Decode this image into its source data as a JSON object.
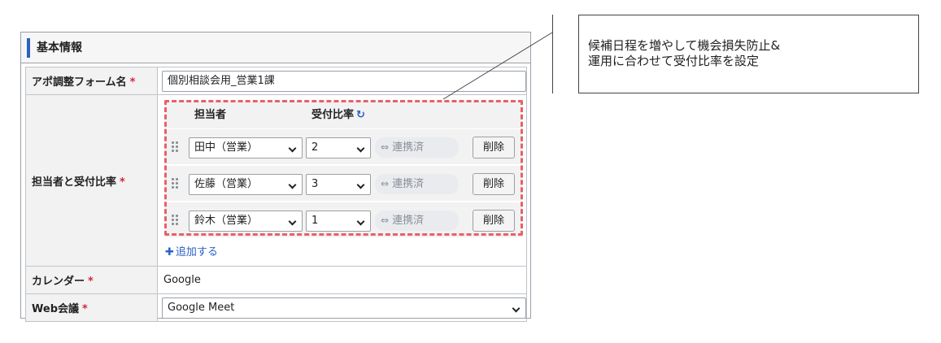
{
  "panel": {
    "title": "基本情報"
  },
  "form": {
    "form_name": {
      "label": "アポ調整フォーム名",
      "required_mark": "*",
      "value": "個別相談会用_営業1課"
    },
    "staff": {
      "label": "担当者と受付比率",
      "required_mark": "*",
      "header_person": "担当者",
      "header_ratio": "受付比率",
      "refresh_icon": "↻",
      "rows": [
        {
          "person": "田中（営業）",
          "ratio": "2",
          "link_icon": "⇔",
          "link_status": "連携済",
          "delete_label": "削除"
        },
        {
          "person": "佐藤（営業）",
          "ratio": "3",
          "link_icon": "⇔",
          "link_status": "連携済",
          "delete_label": "削除"
        },
        {
          "person": "鈴木（営業）",
          "ratio": "1",
          "link_icon": "⇔",
          "link_status": "連携済",
          "delete_label": "削除"
        }
      ],
      "add_icon": "✚",
      "add_label": "追加する"
    },
    "calendar": {
      "label": "カレンダー",
      "required_mark": "*",
      "value": "Google"
    },
    "web_meeting": {
      "label": "Web会議",
      "required_mark": "*",
      "value": "Google Meet"
    }
  },
  "callout": {
    "line1": "候補日程を増やして機会損失防止&",
    "line2": "運用に合わせて受付比率を設定"
  },
  "colors": {
    "accent": "#2b62c4",
    "required": "#d7263d",
    "dashed_border": "#e8606a"
  }
}
